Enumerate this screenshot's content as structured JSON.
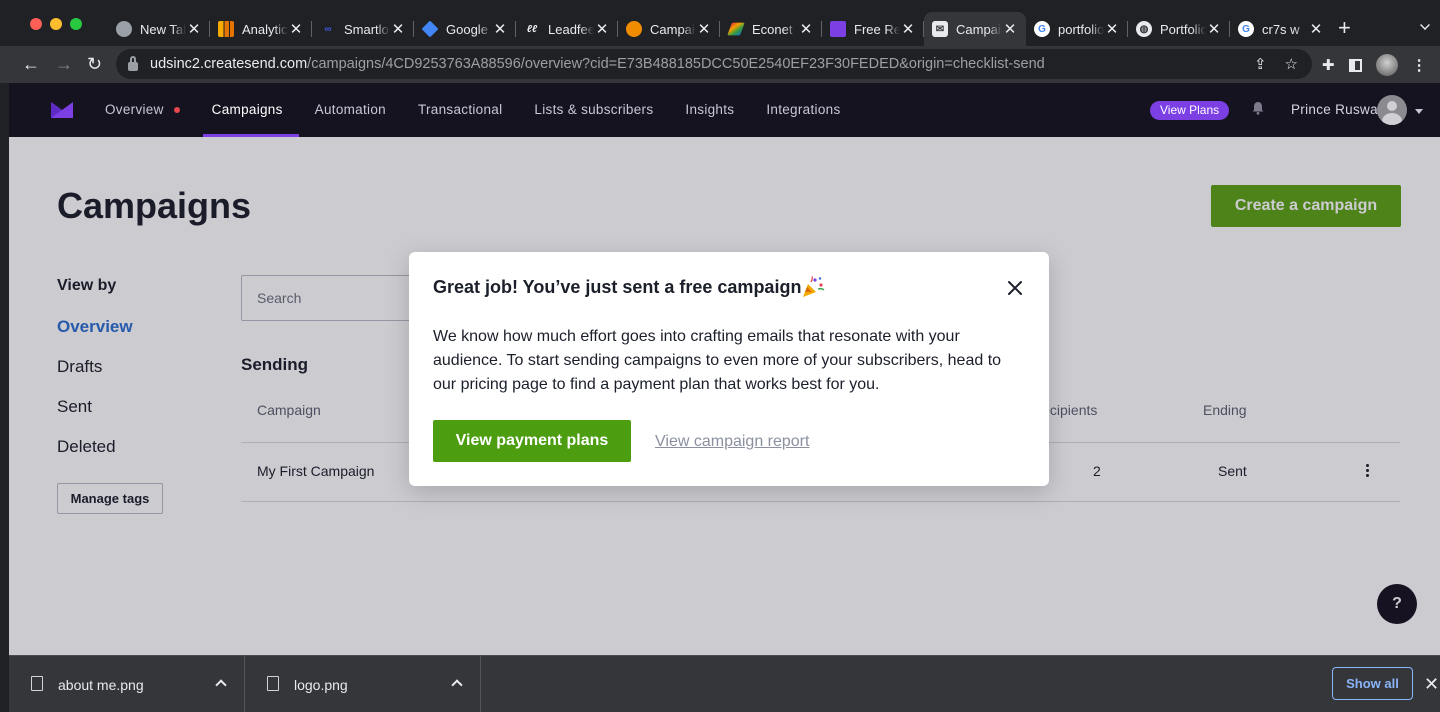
{
  "browser": {
    "tabs": [
      {
        "title": "New Tab",
        "favicon": "chrome-icon",
        "active": false
      },
      {
        "title": "Analytics",
        "favicon": "analytics-icon",
        "active": false
      },
      {
        "title": "Smartlook",
        "favicon": "smartlook-icon",
        "active": false
      },
      {
        "title": "Google Ads",
        "favicon": "google-ads-icon",
        "active": false
      },
      {
        "title": "Leadfeeder",
        "favicon": "leadfeeder-icon",
        "active": false
      },
      {
        "title": "Campaigns",
        "favicon": "campaign-orange-icon",
        "active": false
      },
      {
        "title": "Econet",
        "favicon": "econet-icon",
        "active": false
      },
      {
        "title": "Free Resources",
        "favicon": "createsend-icon",
        "active": false
      },
      {
        "title": "Campaigns",
        "favicon": "campaign-monitor-icon",
        "active": true
      },
      {
        "title": "portfolio",
        "favicon": "google-icon",
        "active": false
      },
      {
        "title": "Portfolio",
        "favicon": "globe-icon",
        "active": false
      },
      {
        "title": "cr7s w",
        "favicon": "google-icon",
        "active": false
      }
    ],
    "url_host": "udsinc2.createsend.com",
    "url_path": "/campaigns/4CD9253763A88596/overview?cid=E73B488185DCC50E2540EF23F30FEDED&origin=checklist-send"
  },
  "nav": {
    "items": [
      {
        "label": "Overview",
        "active": false,
        "dot": true
      },
      {
        "label": "Campaigns",
        "active": true,
        "dot": false
      },
      {
        "label": "Automation",
        "active": false,
        "dot": false
      },
      {
        "label": "Transactional",
        "active": false,
        "dot": false
      },
      {
        "label": "Lists & subscribers",
        "active": false,
        "dot": false
      },
      {
        "label": "Insights",
        "active": false,
        "dot": false
      },
      {
        "label": "Integrations",
        "active": false,
        "dot": false
      }
    ],
    "view_plans": "View Plans",
    "user_name": "Prince Ruswa"
  },
  "page": {
    "title": "Campaigns",
    "create_button": "Create a campaign",
    "view_by_label": "View by",
    "filters": [
      {
        "label": "Overview",
        "active": true
      },
      {
        "label": "Drafts",
        "active": false
      },
      {
        "label": "Sent",
        "active": false
      },
      {
        "label": "Deleted",
        "active": false
      }
    ],
    "manage_tags": "Manage tags",
    "search_placeholder": "Search",
    "section_title": "Sending",
    "table": {
      "headers": [
        "Campaign",
        "Recipients",
        "Ending"
      ],
      "rows": [
        {
          "campaign": "My First Campaign",
          "recipients": "2",
          "ending": "Sent"
        }
      ]
    },
    "help": "?"
  },
  "modal": {
    "title": "Great job! You’ve just sent a free campaign",
    "body": "We know how much effort goes into crafting emails that resonate with your audience. To start sending campaigns to even more of your subscribers, head to our pricing page to find a payment plan that works best for you.",
    "primary_button": "View payment plans",
    "secondary_link": "View campaign report"
  },
  "downloads": {
    "items": [
      {
        "name": "about me.png"
      },
      {
        "name": "logo.png"
      }
    ],
    "show_all": "Show all"
  },
  "colors": {
    "brand_purple": "#7b3fe4",
    "nav_bg": "#161320",
    "create_green": "#5ea317",
    "pay_green": "#4c9d0f",
    "link_blue": "#2b6fd1"
  }
}
